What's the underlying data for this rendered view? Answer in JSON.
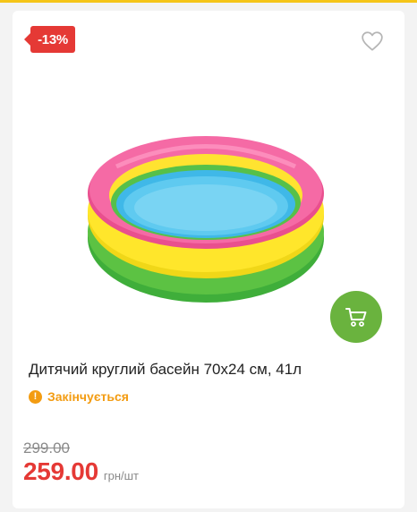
{
  "product": {
    "discount_badge": "-13%",
    "title": "Дитячий круглий басейн 70x24 см, 41л",
    "stock_status": "Закінчується",
    "stock_icon_glyph": "!",
    "old_price": "299.00",
    "price": "259.00",
    "unit": "грн/шт"
  },
  "icons": {
    "wishlist": "heart-outline-icon",
    "cart": "shopping-cart-icon",
    "stock": "warning-icon"
  },
  "colors": {
    "accent_red": "#e53935",
    "cart_green": "#6ab33e",
    "stock_orange": "#f39c12",
    "top_line": "#f5c518"
  }
}
